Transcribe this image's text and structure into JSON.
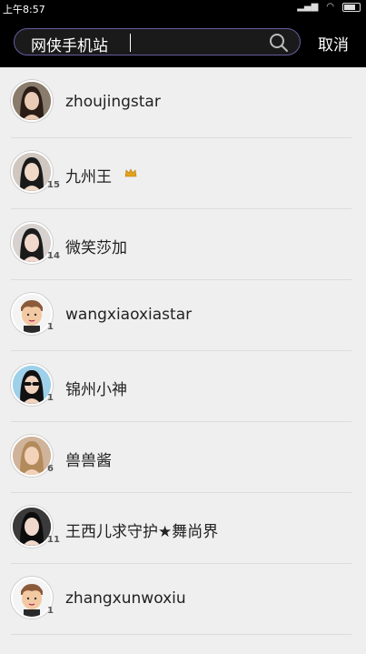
{
  "status_bar": {
    "time": "上午8:57"
  },
  "search": {
    "query": "网侠手机站",
    "cancel_label": "取消"
  },
  "users": [
    {
      "name": "zhoujingstar",
      "level": "",
      "avatar_color": "#8a7c6c",
      "skin": "#e9cbb6",
      "hair": "#2a1d16"
    },
    {
      "name": "九州王",
      "level": "15",
      "avatar_color": "#cfc7c0",
      "skin": "#f1d9c8",
      "hair": "#1a1a1a",
      "crown": true
    },
    {
      "name": "微笑莎加",
      "level": "14",
      "avatar_color": "#d7d2cf",
      "skin": "#f0d9cc",
      "hair": "#1b1b1b"
    },
    {
      "name": "wangxiaoxiastar",
      "level": "1",
      "avatar_color": "#f2f2f2",
      "cartoon": true
    },
    {
      "name": "锦州小神",
      "level": "1",
      "avatar_color": "#9fd0ea",
      "skin": "#efd2bd",
      "hair": "#111111",
      "glasses": true
    },
    {
      "name": "兽兽酱",
      "level": "6",
      "avatar_color": "#cfb39a",
      "skin": "#f2d2b8",
      "hair": "#b38a5a"
    },
    {
      "name": "王西儿求守护★舞尚界",
      "level": "11",
      "avatar_color": "#3a3a3a",
      "skin": "#f0d9cc",
      "hair": "#0d0d0d"
    },
    {
      "name": "zhangxunwoxiu",
      "level": "1",
      "avatar_color": "#f2f2f2",
      "cartoon": true
    }
  ]
}
